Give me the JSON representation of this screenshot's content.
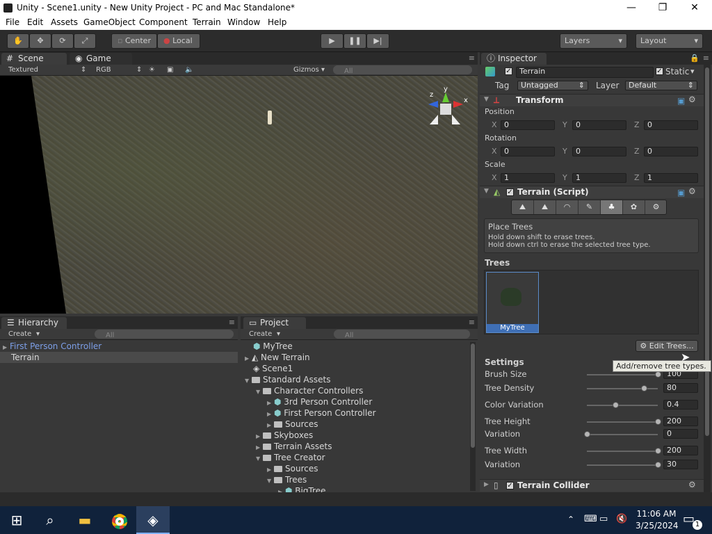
{
  "window": {
    "title": "Unity - Scene1.unity - New Unity Project - PC and Mac Standalone*",
    "minimize": "—",
    "maximize": "❐",
    "close": "✕"
  },
  "menu": [
    "File",
    "Edit",
    "Assets",
    "GameObject",
    "Component",
    "Terrain",
    "Window",
    "Help"
  ],
  "toolbar": {
    "center": "Center",
    "local": "Local",
    "layers": "Layers",
    "layout": "Layout"
  },
  "scene_panel": {
    "tab_scene": "Scene",
    "tab_game": "Game",
    "render_mode": "Textured",
    "color_mode": "RGB",
    "gizmos": "Gizmos",
    "search": "All",
    "axis_x": "x",
    "axis_y": "y",
    "axis_z": "z"
  },
  "hierarchy": {
    "tab": "Hierarchy",
    "create": "Create",
    "search": "All",
    "items": [
      "First Person Controller",
      "Terrain"
    ]
  },
  "project": {
    "tab": "Project",
    "create": "Create",
    "search": "All",
    "items": [
      "MyTree",
      "New Terrain",
      "Scene1",
      "Standard Assets",
      "Character Controllers",
      "3rd Person Controller",
      "First Person Controller",
      "Sources",
      "Skyboxes",
      "Terrain Assets",
      "Tree Creator",
      "Sources",
      "Trees",
      "BigTree"
    ]
  },
  "inspector": {
    "tab": "Inspector",
    "object_name": "Terrain",
    "static": "Static",
    "tag_label": "Tag",
    "tag_value": "Untagged",
    "layer_label": "Layer",
    "layer_value": "Default",
    "transform": {
      "title": "Transform",
      "position": "Position",
      "rotation": "Rotation",
      "scale": "Scale",
      "pos": [
        "0",
        "0",
        "0"
      ],
      "rot": [
        "0",
        "0",
        "0"
      ],
      "scl": [
        "1",
        "1",
        "1"
      ],
      "x": "X",
      "y": "Y",
      "z": "Z"
    },
    "terrain_script": {
      "title": "Terrain (Script)",
      "help_title": "Place Trees",
      "help_line1": "Hold down shift to erase trees.",
      "help_line2": "Hold down ctrl to erase the selected tree type.",
      "trees_label": "Trees",
      "tree_name": "MyTree",
      "edit_trees": "Edit Trees...",
      "tooltip": "Add/remove tree types.",
      "settings_label": "Settings",
      "settings": [
        {
          "label": "Brush Size",
          "value": "100",
          "fraction": 1.0
        },
        {
          "label": "Tree Density",
          "value": "80",
          "fraction": 0.8
        },
        {
          "label": "Color Variation",
          "value": "0.4",
          "fraction": 0.4
        },
        {
          "label": "Tree Height",
          "value": "200",
          "fraction": 1.0
        },
        {
          "label": "Variation",
          "value": "0",
          "fraction": 0.0
        },
        {
          "label": "Tree Width",
          "value": "200",
          "fraction": 1.0
        },
        {
          "label": "Variation",
          "value": "30",
          "fraction": 1.0
        }
      ]
    },
    "terrain_collider": "Terrain Collider"
  },
  "taskbar": {
    "time": "11:06 AM",
    "date": "3/25/2024",
    "notifications": "1"
  }
}
